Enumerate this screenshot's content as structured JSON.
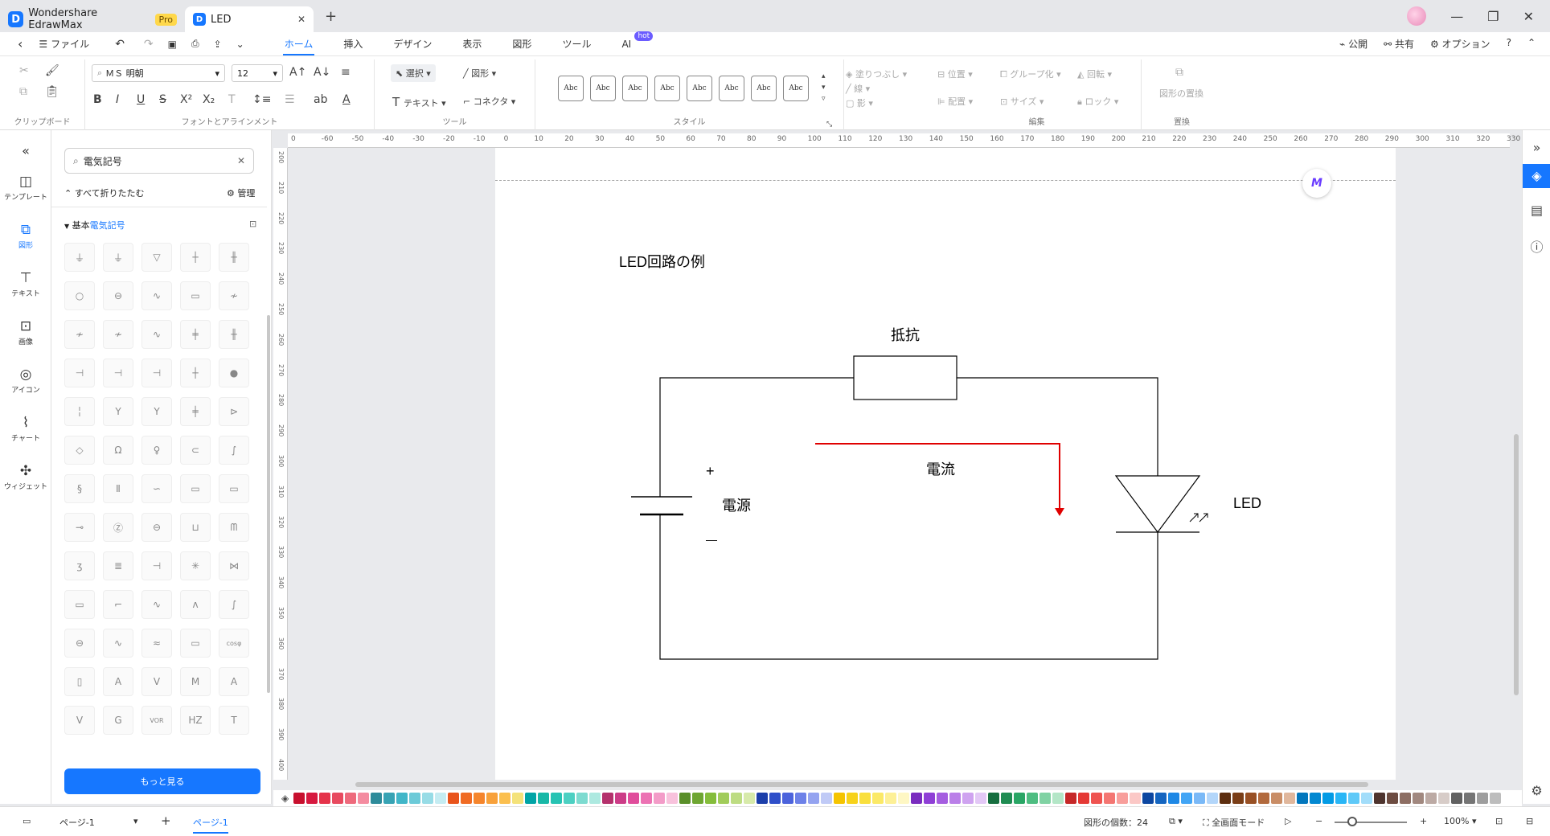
{
  "titlebar": {
    "app_name": "Wondershare EdrawMax",
    "pro_badge": "Pro",
    "doc_tab": "LED",
    "new_tab": "+",
    "win_min": "—",
    "win_restore": "❐",
    "win_close": "✕"
  },
  "menubar": {
    "file": "ファイル",
    "tabs": [
      "ホーム",
      "挿入",
      "デザイン",
      "表示",
      "図形",
      "ツール",
      "AI"
    ],
    "ai_badge": "hot",
    "publish": "公開",
    "share": "共有",
    "options": "オプション"
  },
  "ribbon": {
    "clipboard_label": "クリップボード",
    "font_name": "ＭＳ 明朝",
    "font_size": "12",
    "font_label": "フォントとアラインメント",
    "select": "選択",
    "shape": "図形",
    "text": "テキスト",
    "connector": "コネクタ",
    "tools_label": "ツール",
    "style_sample": "Abc",
    "style_label": "スタイル",
    "fill": "塗りつぶし",
    "line": "線",
    "shadow": "影",
    "position": "位置",
    "group": "グループ化",
    "rotate": "回転",
    "align": "配置",
    "size": "サイズ",
    "lock": "ロック",
    "edit_label": "編集",
    "replace_shape": "図形の置換",
    "replace_label": "置換"
  },
  "leftbar": {
    "items": [
      "テンプレート",
      "図形",
      "テキスト",
      "画像",
      "アイコン",
      "チャート",
      "ウィジェット"
    ]
  },
  "library": {
    "search_value": "電気記号",
    "collapse_all": "すべて折りたたむ",
    "manage": "管理",
    "category_prefix": "基本",
    "category_highlight": "電気記号",
    "more_button": "もっと見る",
    "symbols": [
      "⏚",
      "⏚",
      "▽",
      "┼",
      "╫",
      "○",
      "⊖",
      "∿",
      "▭",
      "≁",
      "≁",
      "≁",
      "∿",
      "╪",
      "╫",
      "⊣",
      "⊣",
      "⊣",
      "┼",
      "●",
      "╎",
      "Y",
      "Y",
      "╪",
      "⊳",
      "◇",
      "Ω",
      "♀",
      "⊂",
      "∫",
      "§",
      "Ⅱ",
      "∽",
      "▭",
      "▭",
      "⊸",
      "Ⓩ",
      "⊖",
      "⊔",
      "ᗰ",
      "ʒ",
      "≣",
      "⊣",
      "✳",
      "⋈",
      "▭",
      "⌐",
      "∿",
      "ᴧ",
      "∫",
      "⊖",
      "∿",
      "≈",
      "▭",
      "cosφ",
      "▯",
      "A",
      "V",
      "M",
      "A",
      "V",
      "G",
      "VOR",
      "HZ",
      "T"
    ]
  },
  "hruler": [
    "0",
    "-60",
    "-50",
    "-40",
    "-30",
    "-20",
    "-10",
    "0",
    "10",
    "20",
    "30",
    "40",
    "50",
    "60",
    "70",
    "80",
    "90",
    "100",
    "110",
    "120",
    "130",
    "140",
    "150",
    "160",
    "170",
    "180",
    "190",
    "200",
    "210",
    "220",
    "230",
    "240",
    "250",
    "260",
    "270",
    "280",
    "290",
    "300",
    "310",
    "320",
    "330"
  ],
  "vruler": [
    "200",
    "210",
    "220",
    "230",
    "240",
    "250",
    "260",
    "270",
    "280",
    "290",
    "300",
    "310",
    "320",
    "330",
    "340",
    "350",
    "360",
    "370",
    "380",
    "390",
    "400"
  ],
  "diagram": {
    "title": "LED回路の例",
    "resistor_label": "抵抗",
    "current_label": "電流",
    "source_label": "電源",
    "led_label": "LED",
    "plus": "+",
    "minus": "—",
    "wire_color": "#000000",
    "current_color": "#e00000"
  },
  "palette": [
    "#c8102e",
    "#d7193f",
    "#e5334a",
    "#e84a5f",
    "#ee6a7c",
    "#f48ca0",
    "#2e8b9a",
    "#37a3b4",
    "#41b6c8",
    "#6ccad8",
    "#97dce6",
    "#c5ecf2",
    "#e9541c",
    "#f06b23",
    "#f5852c",
    "#f8a13a",
    "#fbbf4e",
    "#f4e27a",
    "#00a4a6",
    "#18b8a7",
    "#27c3b3",
    "#4dd0c2",
    "#7ddbd0",
    "#ade9e0",
    "#b4316c",
    "#cc3c87",
    "#e04d9b",
    "#ec72b3",
    "#f39cc8",
    "#f8c2dc",
    "#5a8f29",
    "#6ea632",
    "#85bd3b",
    "#a1cc5a",
    "#bddc82",
    "#d7eaaa",
    "#1c3faa",
    "#2f4fc9",
    "#4c63dc",
    "#6d81e8",
    "#94a3f0",
    "#c0caf6",
    "#f5c400",
    "#f7d21a",
    "#f9df3d",
    "#fbe967",
    "#fdf096",
    "#fef7c4",
    "#7a2cbf",
    "#8f3fd6",
    "#a55de0",
    "#ba7fe8",
    "#cfa3f0",
    "#e3c8f6",
    "#166e3f",
    "#1f8c52",
    "#2aa665",
    "#4ebd81",
    "#80d2a3",
    "#b4e6c7",
    "#c62828",
    "#e53935",
    "#ef5350",
    "#f47672",
    "#f89e9b",
    "#fbc8c6",
    "#0d47a1",
    "#1565c0",
    "#1e88e5",
    "#42a5f5",
    "#7ab9f7",
    "#b3d6fa",
    "#5d2e0f",
    "#7a3e17",
    "#985024",
    "#b26a3d",
    "#c98d66",
    "#e0b79c",
    "#0277bd",
    "#0288d1",
    "#039be5",
    "#29b6f6",
    "#5fc9f8",
    "#a2ddfa",
    "#4e342e",
    "#6d4c41",
    "#8d6e63",
    "#a1887f",
    "#bcaaa4",
    "#d7ccc8",
    "#616161",
    "#757575",
    "#9e9e9e",
    "#bdbdbd",
    "#d6d0c4",
    "#ece6da",
    "#f6f1e8",
    "#212121",
    "#424242",
    "#555555",
    "#6f6f6f",
    "#9a9a9a",
    "#c2c2c2",
    "#e0e0e0",
    "#f5f5f5",
    "#ffffff"
  ],
  "status": {
    "page_name": "ページ-1",
    "page_tab": "ページ-1",
    "shape_count": "図形の個数：24",
    "fullscreen": "全画面モード",
    "zoom": "100%"
  }
}
